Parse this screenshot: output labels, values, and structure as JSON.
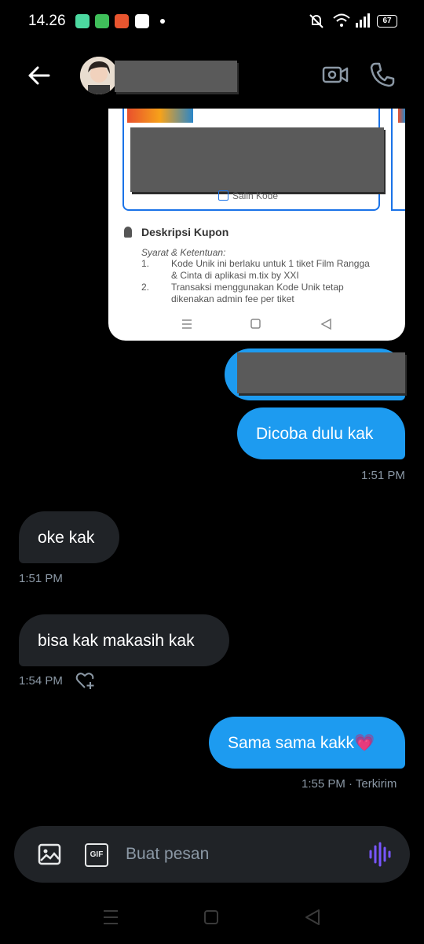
{
  "status_bar": {
    "time": "14.26",
    "battery": "67"
  },
  "header": {
    "back_icon": "arrow-left-icon",
    "video_icon": "video-call-icon",
    "phone_icon": "phone-icon"
  },
  "shared_image": {
    "salin_kode": "Salin Kode",
    "deskripsi_title": "Deskripsi Kupon",
    "syarat_title": "Syarat & Ketentuan:",
    "terms": [
      {
        "num": "1.",
        "line1": "Kode Unik ini berlaku untuk 1 tiket Film Rangga",
        "line2": "& Cinta di aplikasi m.tix by XXI"
      },
      {
        "num": "2.",
        "line1": "Transaksi menggunakan Kode Unik tetap",
        "line2": "dikenakan admin fee per tiket"
      }
    ]
  },
  "messages": [
    {
      "side": "right",
      "text": "Dicoba dulu kak",
      "time": "1:51 PM"
    },
    {
      "side": "left",
      "text": "oke kak",
      "time": "1:51 PM"
    },
    {
      "side": "left",
      "text": "bisa kak makasih kak",
      "time": "1:54 PM"
    },
    {
      "side": "right",
      "text": "Sama sama kakk💗",
      "time": "1:55 PM · Terkirim"
    }
  ],
  "composer": {
    "placeholder": "Buat pesan",
    "gif_label": "GIF"
  }
}
